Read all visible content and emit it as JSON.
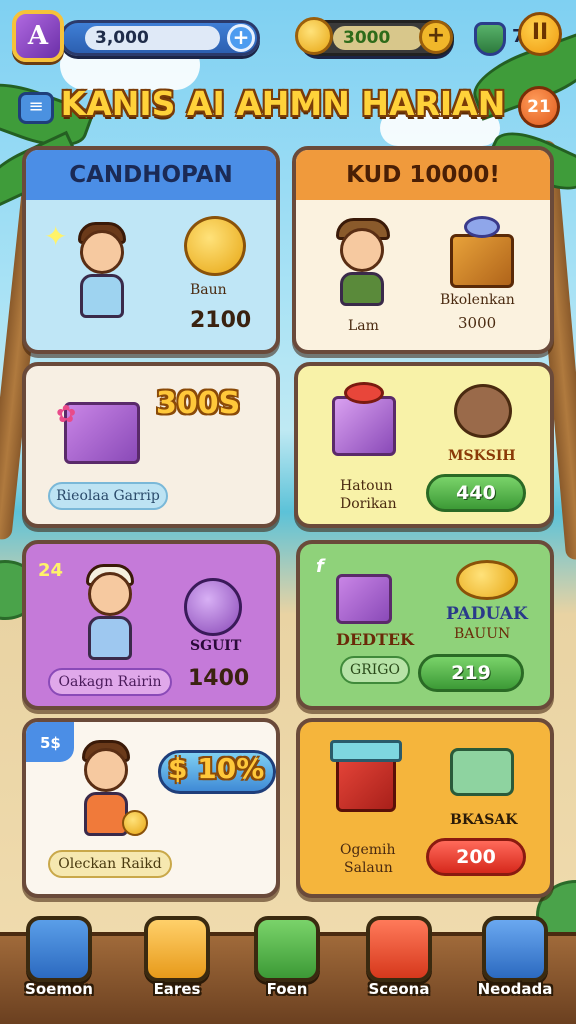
{
  "top_bar": {
    "gems_value": "3,000",
    "gems_plus": "+",
    "coins_value": "3000",
    "coins_plus": "+",
    "level_value": "7",
    "pause_label": "II"
  },
  "title_row": {
    "menu_icon": "≡",
    "title": "KANIS AI AHMN HARIAN",
    "timer_value": "21"
  },
  "cards": {
    "c1": {
      "header": "CANDHOPAN",
      "reward_label": "Baun",
      "reward_value": "2100"
    },
    "c2": {
      "header": "KUD 10000!",
      "char_label": "Lam",
      "reward_label": "Bkolenkan",
      "reward_value": "3000"
    },
    "c3": {
      "big_value": "300S",
      "badge_label": "Rieolaa Garrip"
    },
    "c4": {
      "reward_label": "MSKSIH",
      "item_label_line1": "Hatoun",
      "item_label_line2": "Dorikan",
      "button_value": "440"
    },
    "c5": {
      "corner_tag": "24",
      "reward_label": "SGUIT",
      "reward_value": "1400",
      "badge_label": "Oakagn Rairin"
    },
    "c6": {
      "corner_tag": "f",
      "item_label": "DEDTEK",
      "badge_label": "GRIGO",
      "title_label_line1": "PADUAK",
      "title_label_line2": "BAUUN",
      "button_value": "219"
    },
    "c7": {
      "corner_tag": "5$",
      "big_value": "$ 10%",
      "badge_label": "Oleckan Raikd"
    },
    "c8": {
      "item_label_line1": "Ogemih",
      "item_label_line2": "Salaun",
      "reward_label": "BKASAK",
      "button_value": "200"
    }
  },
  "bottom_nav": [
    {
      "label": "Soemon",
      "icon": "hammer-icon",
      "color": "#3f86d8"
    },
    {
      "label": "Eares",
      "icon": "tools-icon",
      "color": "#f0b53a"
    },
    {
      "label": "Foen",
      "icon": "torch-icon",
      "color": "#4cae43"
    },
    {
      "label": "Sceona",
      "icon": "map-icon",
      "color": "#e24a3a"
    },
    {
      "label": "Neodada",
      "icon": "profile-icon",
      "color": "#4b8ee0"
    }
  ],
  "colors": {
    "c1_header": "#4b8ee6",
    "c1_body": "#bfe6f6",
    "c2_header": "#f09a3c",
    "c2_body": "#fbf2df",
    "c3_body": "#f7efe3",
    "c4_body": "#f8f2a8",
    "c5_body": "#c57ad9",
    "c6_body": "#8fd27a",
    "c7_body": "#fbf6ee",
    "c8_body": "#f5b53c"
  }
}
